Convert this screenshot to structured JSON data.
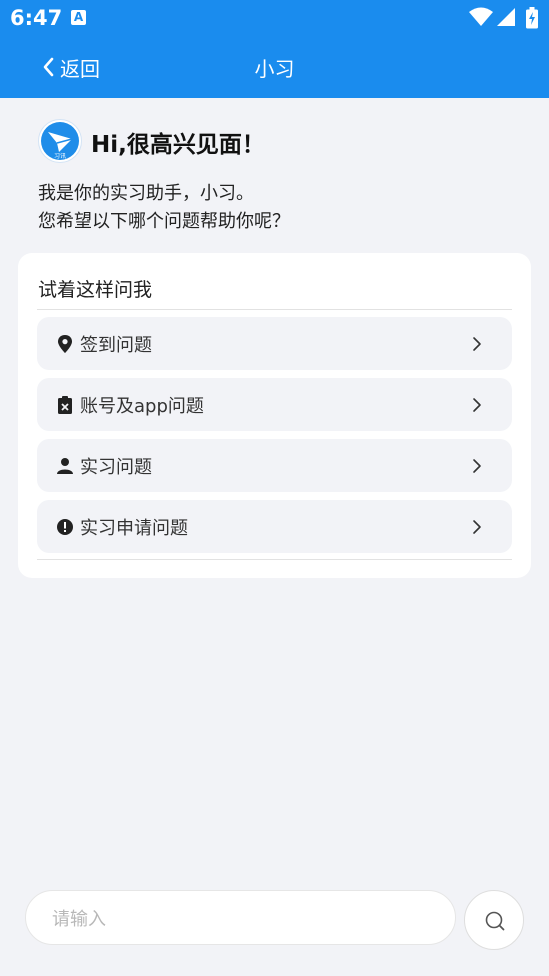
{
  "status_bar": {
    "time": "6:47",
    "notification_badge": "A"
  },
  "nav": {
    "back_label": "返回",
    "title": "小习"
  },
  "greeting": {
    "title": "Hi,很高兴见面！",
    "line1": "我是你的实习助手，小习。",
    "line2": "您希望以下哪个问题帮助你呢？",
    "logo_text": "习讯"
  },
  "card": {
    "title": "试着这样问我",
    "items": [
      {
        "label": "签到问题",
        "icon": "location-pin-icon"
      },
      {
        "label": "账号及app问题",
        "icon": "clipboard-x-icon"
      },
      {
        "label": "实习问题",
        "icon": "person-icon"
      },
      {
        "label": "实习申请问题",
        "icon": "alert-circle-icon"
      }
    ]
  },
  "input": {
    "placeholder": "请输入",
    "value": ""
  },
  "colors": {
    "primary": "#1a8cee",
    "background": "#f2f3f7"
  }
}
